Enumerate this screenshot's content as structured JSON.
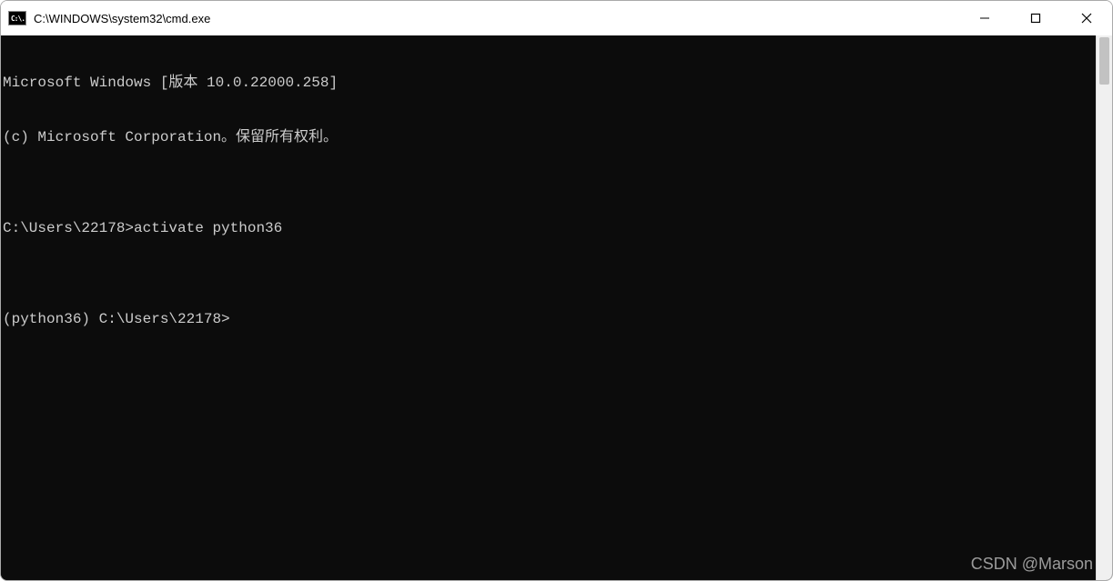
{
  "titlebar": {
    "icon_label": "C:\\.",
    "title": "C:\\WINDOWS\\system32\\cmd.exe"
  },
  "terminal": {
    "lines": [
      "Microsoft Windows [版本 10.0.22000.258]",
      "(c) Microsoft Corporation。保留所有权利。",
      "",
      "C:\\Users\\22178>activate python36",
      "",
      "(python36) C:\\Users\\22178>"
    ]
  },
  "watermark": "CSDN @Marson"
}
